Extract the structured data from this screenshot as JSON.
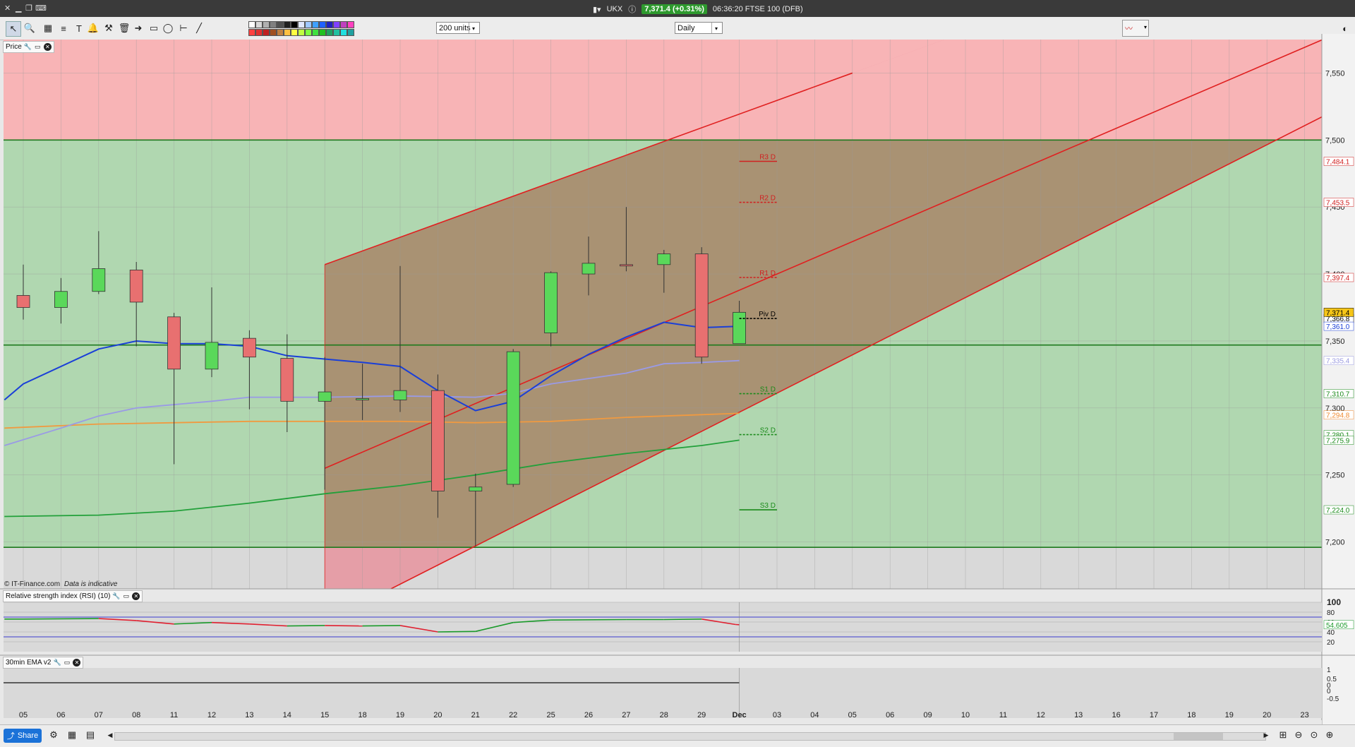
{
  "window": {
    "instrument": "UKX",
    "price_badge": "7,371.4 (+0.31%)",
    "status": "06:36:20 FTSE 100 (DFB)"
  },
  "toolbar": {
    "units_select": "200 units",
    "interval_select": "Daily",
    "color_swatches_top": [
      "#ffffff",
      "#d8d8d8",
      "#b0b0b0",
      "#808080",
      "#505050",
      "#202020",
      "#000000",
      "#e0e8ff",
      "#a0c8ff",
      "#40a0ff",
      "#2060ff",
      "#2020c0",
      "#8040ff",
      "#c040c0",
      "#ff40c0"
    ],
    "color_swatches_bottom": [
      "#ff4040",
      "#e03030",
      "#c02020",
      "#a05020",
      "#c08040",
      "#ffc040",
      "#ffff40",
      "#c0ff40",
      "#80ff40",
      "#40e040",
      "#20c020",
      "#20a060",
      "#20c0a0",
      "#20e0e0",
      "#20a0a0"
    ]
  },
  "price_panel": {
    "label": "Price",
    "watermark": "© IT-Finance.com",
    "watermark_note": "Data is indicative"
  },
  "rsi_panel": {
    "label": "Relative strength index (RSI) (10)",
    "value_label": "54.605"
  },
  "ema_panel": {
    "label": "30min EMA v2"
  },
  "statusbar": {
    "share_label": "Share"
  },
  "chart_data": {
    "type": "candlestick",
    "x_labels": [
      "05",
      "06",
      "07",
      "08",
      "11",
      "12",
      "13",
      "14",
      "15",
      "18",
      "19",
      "20",
      "21",
      "22",
      "25",
      "26",
      "27",
      "28",
      "29",
      "Dec",
      "03",
      "04",
      "05",
      "06",
      "09",
      "10",
      "11",
      "12",
      "13",
      "16",
      "17",
      "18",
      "19",
      "20",
      "23"
    ],
    "y_ticks": [
      7200,
      7250,
      7300,
      7350,
      7400,
      7450,
      7500,
      7550
    ],
    "y_tick_labels": [
      "7,200",
      "7,250",
      "7,300",
      "7,350",
      "7,400",
      "7,450",
      "7,500",
      "7,550"
    ],
    "ylim": [
      7165,
      7575
    ],
    "candles": [
      {
        "x": "05",
        "open": 7384,
        "high": 7407,
        "low": 7366,
        "close": 7375
      },
      {
        "x": "06",
        "open": 7375,
        "high": 7397,
        "low": 7363,
        "close": 7387
      },
      {
        "x": "07",
        "open": 7387,
        "high": 7432,
        "low": 7385,
        "close": 7404
      },
      {
        "x": "08",
        "open": 7403,
        "high": 7409,
        "low": 7346,
        "close": 7379
      },
      {
        "x": "11",
        "open": 7368,
        "high": 7371,
        "low": 7258,
        "close": 7329
      },
      {
        "x": "12",
        "open": 7329,
        "high": 7390,
        "low": 7323,
        "close": 7349
      },
      {
        "x": "13",
        "open": 7352,
        "high": 7358,
        "low": 7299,
        "close": 7338
      },
      {
        "x": "14",
        "open": 7337,
        "high": 7355,
        "low": 7282,
        "close": 7305
      },
      {
        "x": "15",
        "open": 7305,
        "high": 7338,
        "low": 7239,
        "close": 7312
      },
      {
        "x": "18",
        "open": 7306,
        "high": 7333,
        "low": 7291,
        "close": 7307
      },
      {
        "x": "19",
        "open": 7306,
        "high": 7406,
        "low": 7297,
        "close": 7313
      },
      {
        "x": "20",
        "open": 7313,
        "high": 7325,
        "low": 7218,
        "close": 7238
      },
      {
        "x": "21",
        "open": 7238,
        "high": 7251,
        "low": 7197,
        "close": 7241
      },
      {
        "x": "22",
        "open": 7243,
        "high": 7344,
        "low": 7241,
        "close": 7342
      },
      {
        "x": "25",
        "open": 7356,
        "high": 7402,
        "low": 7346,
        "close": 7401
      },
      {
        "x": "26",
        "open": 7400,
        "high": 7428,
        "low": 7384,
        "close": 7408
      },
      {
        "x": "27",
        "open": 7407,
        "high": 7450,
        "low": 7402,
        "close": 7406
      },
      {
        "x": "28",
        "open": 7407,
        "high": 7418,
        "low": 7386,
        "close": 7415
      },
      {
        "x": "29",
        "open": 7415,
        "high": 7420,
        "low": 7333,
        "close": 7338
      },
      {
        "x": "Dec",
        "open": 7348,
        "high": 7380,
        "low": 7348,
        "close": 7371.4
      }
    ],
    "ma_blue": [
      [
        -0.5,
        7306
      ],
      [
        0,
        7318
      ],
      [
        2,
        7344
      ],
      [
        3,
        7350
      ],
      [
        4,
        7348
      ],
      [
        5,
        7348
      ],
      [
        6,
        7346
      ],
      [
        7,
        7339
      ],
      [
        9,
        7334
      ],
      [
        10,
        7331
      ],
      [
        11,
        7313
      ],
      [
        12,
        7298
      ],
      [
        13,
        7305
      ],
      [
        14,
        7324
      ],
      [
        15,
        7340
      ],
      [
        16,
        7353
      ],
      [
        17,
        7364
      ],
      [
        18,
        7360
      ],
      [
        19,
        7361
      ]
    ],
    "ma_lilac": [
      [
        -0.5,
        7272
      ],
      [
        1,
        7285
      ],
      [
        2,
        7294
      ],
      [
        3,
        7300
      ],
      [
        5,
        7305
      ],
      [
        6,
        7308
      ],
      [
        8,
        7308
      ],
      [
        10,
        7309
      ],
      [
        12,
        7308
      ],
      [
        13,
        7311
      ],
      [
        14,
        7318
      ],
      [
        16,
        7326
      ],
      [
        17,
        7333
      ],
      [
        18,
        7334
      ],
      [
        19,
        7335.4
      ]
    ],
    "ma_orange": [
      [
        -0.5,
        7285
      ],
      [
        2,
        7288
      ],
      [
        6,
        7290
      ],
      [
        10,
        7290
      ],
      [
        12,
        7289
      ],
      [
        14,
        7290
      ],
      [
        16,
        7293
      ],
      [
        18,
        7295
      ],
      [
        19,
        7296
      ]
    ],
    "ma_green": [
      [
        -0.5,
        7219
      ],
      [
        2,
        7220
      ],
      [
        4,
        7223
      ],
      [
        6,
        7229
      ],
      [
        8,
        7236
      ],
      [
        10,
        7242
      ],
      [
        12,
        7250
      ],
      [
        14,
        7259
      ],
      [
        16,
        7266
      ],
      [
        18,
        7272
      ],
      [
        19,
        7276
      ]
    ],
    "pivots": [
      {
        "name": "R3 D",
        "value": 7484.1,
        "label": "7,484.1",
        "color": "#d02020",
        "dashed": false
      },
      {
        "name": "R2 D",
        "value": 7453.5,
        "label": "7,453.5",
        "color": "#d02020",
        "dashed": true
      },
      {
        "name": "R1 D",
        "value": 7397.4,
        "label": "7,397.4",
        "color": "#d02020",
        "dashed": true
      },
      {
        "name": "Piv D",
        "value": 7366.8,
        "label": "7,366.8",
        "color": "#000000",
        "dashed": true
      },
      {
        "name": "S1 D",
        "value": 7310.7,
        "label": "7,310.7",
        "color": "#1a8a1a",
        "dashed": true
      },
      {
        "name": "S2 D",
        "value": 7280.1,
        "label": "7,280.1",
        "color": "#1a8a1a",
        "dashed": true
      },
      {
        "name": "S3 D",
        "value": 7224.0,
        "label": "7,224.0",
        "color": "#1a8a1a",
        "dashed": false
      }
    ],
    "right_labels": [
      {
        "value": 7371.4,
        "label": "7,371.4",
        "bg": "#f5c518",
        "fg": "#000000"
      },
      {
        "value": 7361.0,
        "label": "7,361.0",
        "bg": "#ffffff",
        "fg": "#1a3fd8"
      },
      {
        "value": 7335.4,
        "label": "7,335.4",
        "bg": "#ffffff",
        "fg": "#9a9ae0"
      },
      {
        "value": 7294.8,
        "label": "7,294.8",
        "bg": "#ffffff",
        "fg": "#f08a30"
      },
      {
        "value": 7275.9,
        "label": "7,275.9",
        "bg": "#ffffff",
        "fg": "#1a8a1a"
      }
    ],
    "horizontal_lines": [
      7500,
      7347,
      7196
    ],
    "channel": {
      "start_x": 8,
      "box_top_left": [
        8,
        7407
      ],
      "upper": [
        [
          8,
          7407
        ],
        [
          22,
          7550
        ]
      ],
      "middle": [
        [
          8,
          7255
        ],
        [
          32,
          7545
        ]
      ],
      "lower": [
        [
          12,
          7197
        ],
        [
          35,
          7525
        ]
      ]
    },
    "rsi": {
      "ylim": [
        0,
        100
      ],
      "y_tick_labels": [
        "100",
        "80",
        "60",
        "40",
        "20"
      ],
      "upper_band": 70,
      "lower_band": 30,
      "values": [
        [
          -0.5,
          66
        ],
        [
          0,
          66
        ],
        [
          2,
          67
        ],
        [
          3,
          63
        ],
        [
          4,
          56
        ],
        [
          5,
          59
        ],
        [
          6,
          56
        ],
        [
          7,
          52
        ],
        [
          8,
          53
        ],
        [
          9,
          52
        ],
        [
          10,
          53
        ],
        [
          11,
          40
        ],
        [
          12,
          41
        ],
        [
          13,
          59
        ],
        [
          14,
          64
        ],
        [
          16,
          65
        ],
        [
          17,
          65
        ],
        [
          18,
          66
        ],
        [
          18.9,
          55
        ],
        [
          19,
          54.605
        ]
      ]
    },
    "ema30": {
      "y_tick_labels": [
        "1",
        "0.5",
        "0",
        "0",
        "-0.5"
      ]
    }
  }
}
